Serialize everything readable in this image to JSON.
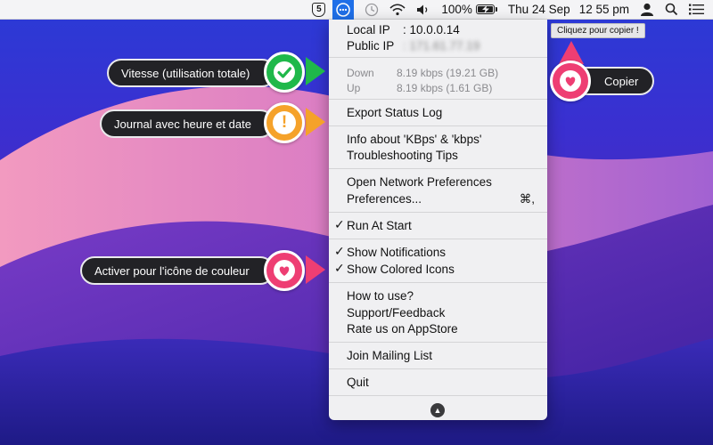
{
  "menubar": {
    "shield_label": "5",
    "battery_percent_text": "100%",
    "battery_level": 1.0,
    "date": "Thu 24 Sep",
    "time": "12 55 pm"
  },
  "menu": {
    "local_ip_label": "Local IP",
    "local_ip_value": ": 10.0.0.14",
    "public_ip_label": "Public IP",
    "public_ip_value": ": 171.61.77.19",
    "down_label": "Down",
    "down_value": "8.19 kbps (19.21 GB)",
    "up_label": "Up",
    "up_value": "8.19 kbps (1.61 GB)",
    "export": "Export Status Log",
    "info_units": "Info about 'KBps' & 'kbps'",
    "troubleshooting": "Troubleshooting Tips",
    "open_network": "Open Network Preferences",
    "preferences": "Preferences...",
    "preferences_shortcut": "⌘,",
    "run_at_start": "Run At Start",
    "show_notifications": "Show Notifications",
    "show_colored_icons": "Show Colored Icons",
    "how_to_use": "How to use?",
    "support": "Support/Feedback",
    "rate": "Rate us on AppStore",
    "join_mailing": "Join Mailing List",
    "quit": "Quit",
    "check_mark": "✓",
    "scroll_glyph": "▲"
  },
  "callouts": {
    "speed": "Vitesse (utilisation totale)",
    "log": "Journal avec heure et date",
    "color_icon": "Activer pour l'icône de couleur",
    "copy": "Copier",
    "tooltip": "Cliquez pour copier !",
    "exclamation": "!"
  },
  "colors": {
    "green": "#1fb84a",
    "orange": "#f5a22a",
    "pink": "#ee3e73",
    "menubar_active": "#1f6fe8"
  }
}
